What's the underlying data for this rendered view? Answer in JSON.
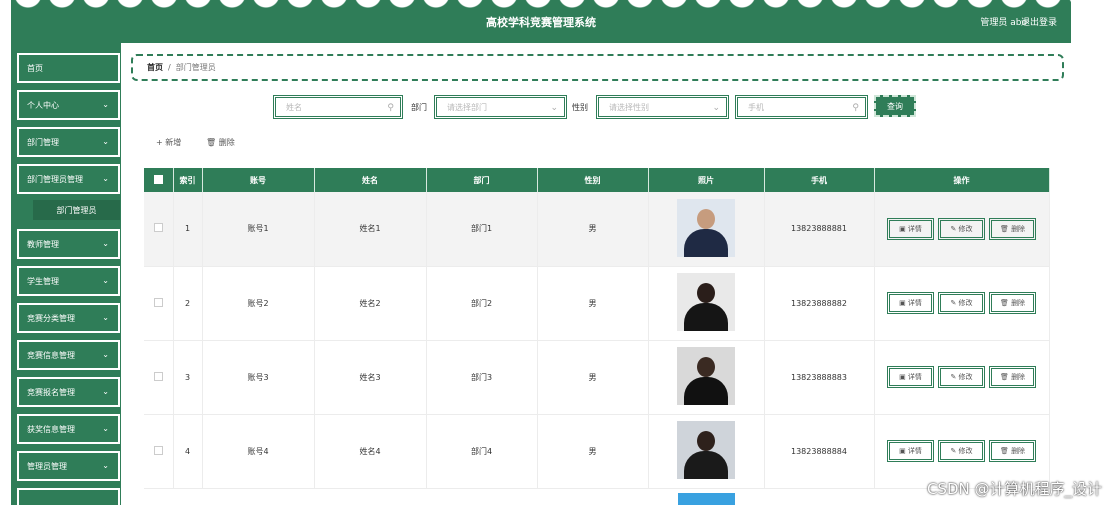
{
  "header": {
    "title": "高校学科竞赛管理系统",
    "user": "管理员 abo",
    "logout": "退出登录"
  },
  "sidebar": {
    "items": [
      {
        "label": "首页",
        "chevron": false
      },
      {
        "label": "个人中心",
        "chevron": true
      },
      {
        "label": "部门管理",
        "chevron": true
      },
      {
        "label": "部门管理员管理",
        "chevron": true
      },
      {
        "label": "教师管理",
        "chevron": true
      },
      {
        "label": "学生管理",
        "chevron": true
      },
      {
        "label": "竞赛分类管理",
        "chevron": true
      },
      {
        "label": "竞赛信息管理",
        "chevron": true
      },
      {
        "label": "竞赛报名管理",
        "chevron": true
      },
      {
        "label": "获奖信息管理",
        "chevron": true
      },
      {
        "label": "管理员管理",
        "chevron": true
      }
    ],
    "sub_item": "部门管理员"
  },
  "breadcrumb": {
    "home": "首页",
    "sep": "/",
    "current": "部门管理员"
  },
  "search": {
    "name_placeholder": "姓名",
    "dept_label": "部门",
    "dept_placeholder": "请选择部门",
    "gender_label": "性别",
    "gender_placeholder": "请选择性别",
    "phone_placeholder": "手机",
    "query_button": "查询"
  },
  "toolbar": {
    "add": "+ 新增",
    "delete": "删除"
  },
  "table": {
    "headers": [
      "索引",
      "账号",
      "姓名",
      "部门",
      "性别",
      "照片",
      "手机",
      "操作"
    ],
    "rows": [
      {
        "index": "1",
        "account": "账号1",
        "name": "姓名1",
        "dept": "部门1",
        "gender": "男",
        "phone": "13823888881"
      },
      {
        "index": "2",
        "account": "账号2",
        "name": "姓名2",
        "dept": "部门2",
        "gender": "男",
        "phone": "13823888882"
      },
      {
        "index": "3",
        "account": "账号3",
        "name": "姓名3",
        "dept": "部门3",
        "gender": "男",
        "phone": "13823888883"
      },
      {
        "index": "4",
        "account": "账号4",
        "name": "姓名4",
        "dept": "部门4",
        "gender": "男",
        "phone": "13823888884"
      }
    ],
    "actions": {
      "detail": "详情",
      "edit": "修改",
      "delete": "删除"
    }
  },
  "watermark": "CSDN @计算机程序_设计",
  "colors": {
    "primary": "#2f7d58"
  }
}
